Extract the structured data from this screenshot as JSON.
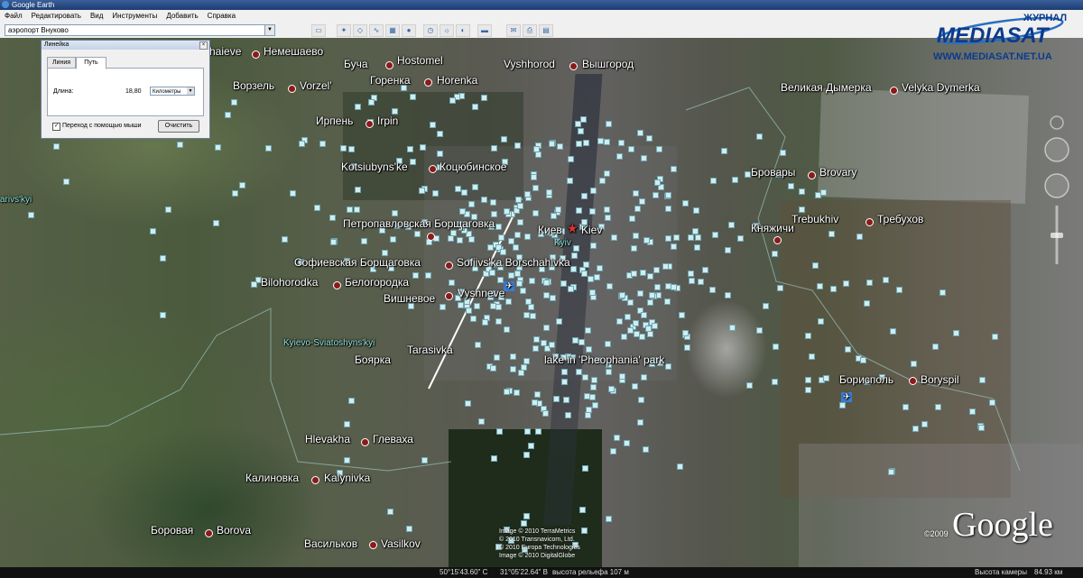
{
  "window": {
    "title": "Google Earth"
  },
  "menu": [
    "Файл",
    "Редактировать",
    "Вид",
    "Инструменты",
    "Добавить",
    "Справка"
  ],
  "search": {
    "value": "аэропорт Внуково"
  },
  "ruler": {
    "title": "Линейка",
    "tabs": [
      "Линия",
      "Путь"
    ],
    "active_tab": "Путь",
    "length_label": "Длина:",
    "length_value": "18,80",
    "units": "Километры",
    "mouse_nav_label": "Переход с помощью мыши",
    "mouse_nav_checked": true,
    "clear_button": "Очистить"
  },
  "map_labels": [
    {
      "text": "haieve",
      "dot": false
    },
    {
      "text": "Немешаево",
      "dot": true
    },
    {
      "text": "Буча",
      "dot": true
    },
    {
      "text": "Hostomel",
      "dot": false
    },
    {
      "text": "Vyshhorod",
      "dot": true
    },
    {
      "text": "Вышгород",
      "dot": false
    },
    {
      "text": "Ворзель",
      "dot": true
    },
    {
      "text": "Vorzel'",
      "dot": false
    },
    {
      "text": "Горенка",
      "dot": true
    },
    {
      "text": "Horenka",
      "dot": false
    },
    {
      "text": "Ирпень",
      "dot": true
    },
    {
      "text": "Irpin",
      "dot": false
    },
    {
      "text": "Великая Дымерка",
      "dot": true
    },
    {
      "text": "Velyka Dymerka",
      "dot": false
    },
    {
      "text": "Kotsiubyns'ke",
      "dot": true
    },
    {
      "text": "Коцюбинское",
      "dot": false
    },
    {
      "text": "Бровары",
      "dot": true
    },
    {
      "text": "Brovary",
      "dot": false
    },
    {
      "text": "arivs'kyi",
      "dot": false
    },
    {
      "text": "Петропавловская Борщаговка",
      "dot": true
    },
    {
      "text": "Киев",
      "dot": false
    },
    {
      "text": "Kiev",
      "dot": false
    },
    {
      "text": "Kyiv",
      "dot": false
    },
    {
      "text": "Trebukhiv",
      "dot": true
    },
    {
      "text": "Требухов",
      "dot": false
    },
    {
      "text": "Княжичи",
      "dot": true
    },
    {
      "text": "Софиевская Борщаговка",
      "dot": true
    },
    {
      "text": "Sofiivs'ka Borschahivka",
      "dot": false
    },
    {
      "text": "Bilohorodka",
      "dot": true
    },
    {
      "text": "Белогородка",
      "dot": false
    },
    {
      "text": "Вишневое",
      "dot": true
    },
    {
      "text": "Vyshneve",
      "dot": false
    },
    {
      "text": "Kyievo-Sviatoshyns'kyi",
      "dot": false
    },
    {
      "text": "Tarasivka",
      "dot": false
    },
    {
      "text": "Боярка",
      "dot": false
    },
    {
      "text": "lake in 'Pheophania' park",
      "dot": false
    },
    {
      "text": "Борисполь",
      "dot": true
    },
    {
      "text": "Boryspil",
      "dot": false
    },
    {
      "text": "Hlevakha",
      "dot": true
    },
    {
      "text": "Глеваха",
      "dot": false
    },
    {
      "text": "Калиновка",
      "dot": true
    },
    {
      "text": "Kalynivka",
      "dot": false
    },
    {
      "text": "Боровая",
      "dot": true
    },
    {
      "text": "Borova",
      "dot": false
    },
    {
      "text": "Васильков",
      "dot": true
    },
    {
      "text": "Vasilkov",
      "dot": false
    }
  ],
  "attribution": [
    "Image © 2010 TerraMetrics",
    "© 2010 Transnavicom, Ltd.",
    "© 2010 Europa Technologies",
    "Image © 2010 DigitalGlobe"
  ],
  "google_logo": "Google",
  "copyright_year": "©2009",
  "branding": {
    "line1": "ЖУРНАЛ",
    "line2": "MEDIASAT",
    "url": "WWW.MEDIASAT.NET.UA"
  },
  "status": {
    "latitude": "50°15'43.60\" С",
    "longitude": "31°05'22.64\" В",
    "elevation": "высота рельефа  107 м",
    "eye_alt_label": "Высота камеры",
    "eye_alt_value": "84.93 км"
  },
  "colors": {
    "place_dot": "#8b1a1a",
    "path_line": "#ffffff",
    "marker": "#cfeef0",
    "title_bar": "#2a4c86"
  }
}
